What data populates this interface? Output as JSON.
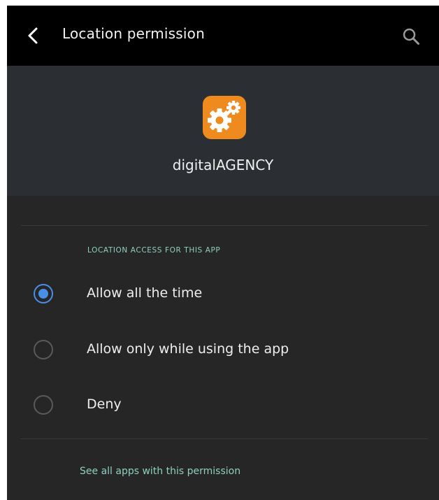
{
  "toolbar": {
    "title": "Location permission",
    "back_icon": "chevron-left-icon",
    "search_icon": "search-icon"
  },
  "app": {
    "name": "digitalAGENCY",
    "icon": "gears-icon",
    "icon_color": "#ef8a1f"
  },
  "permission": {
    "section_label": "LOCATION ACCESS FOR THIS APP",
    "options": [
      {
        "label": "Allow all the time",
        "selected": true
      },
      {
        "label": "Allow only while using the app",
        "selected": false
      },
      {
        "label": "Deny",
        "selected": false
      }
    ],
    "see_all_link": "See all apps with this permission"
  },
  "colors": {
    "accent": "#4a8fe7",
    "link": "#8fd0c0",
    "toolbar_bg": "#000000",
    "background": "#262626"
  }
}
